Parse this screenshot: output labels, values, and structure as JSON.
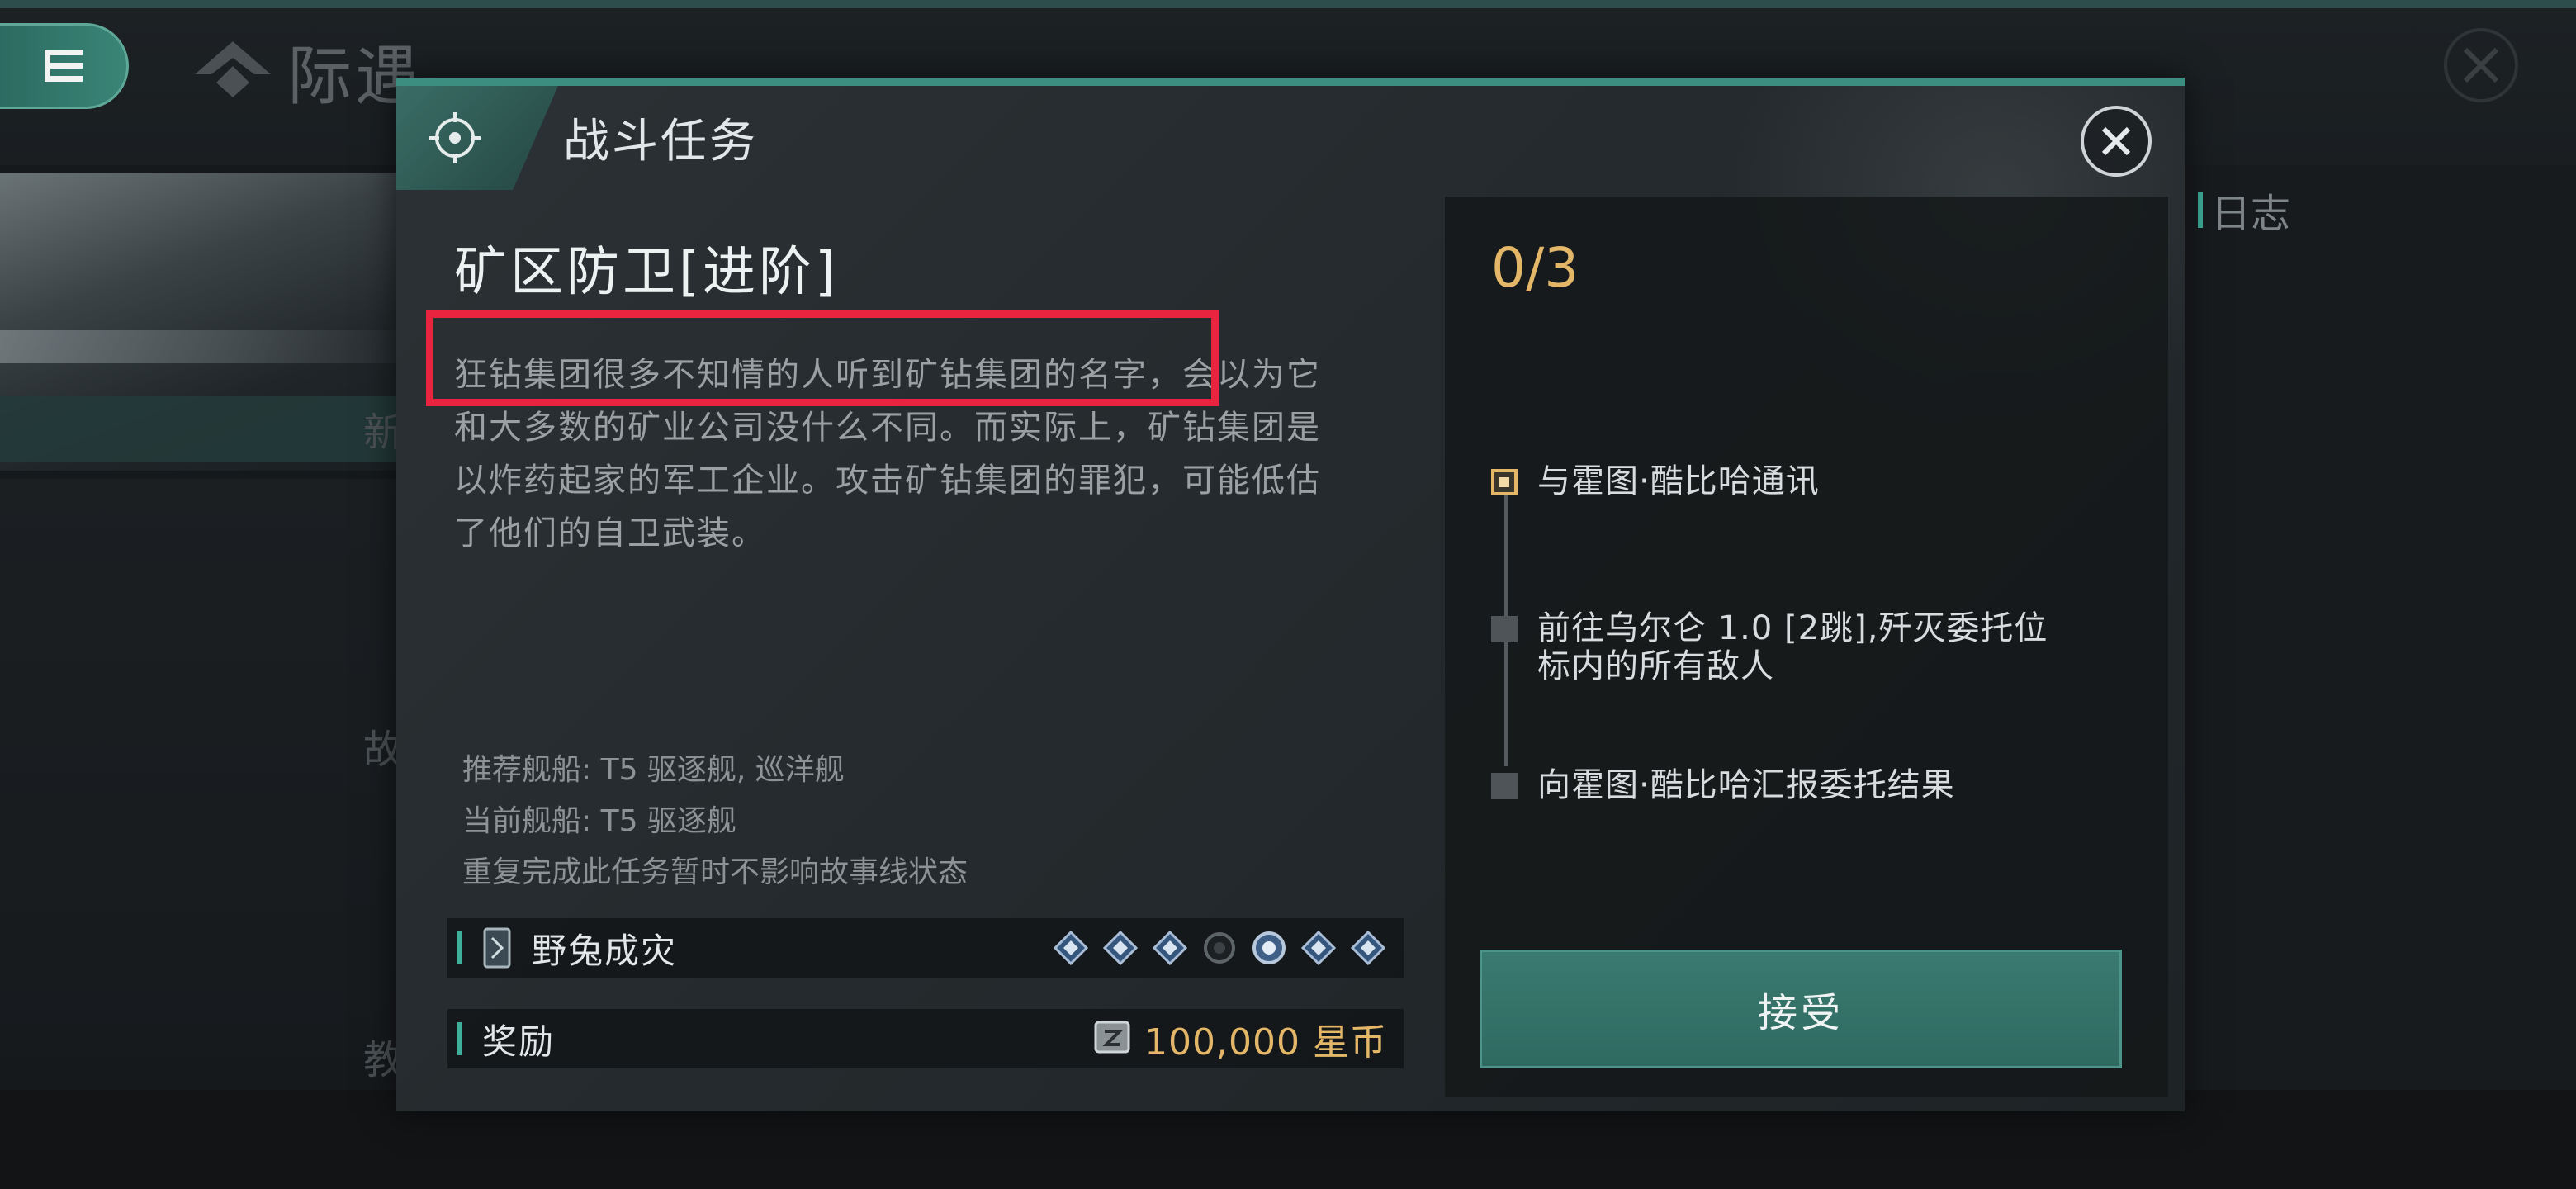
{
  "background": {
    "brand_title": "际遇",
    "log_label": "日志",
    "fragments": [
      "新",
      "故",
      "教"
    ]
  },
  "modal": {
    "title": "战斗任务",
    "mission_name": "矿区防卫[进阶]",
    "description": "狂钻集团很多不知情的人听到矿钻集团的名字，会以为它和大多数的矿业公司没什么不同。而实际上，矿钻集团是以炸药起家的军工企业。攻击矿钻集团的罪犯，可能低估了他们的自卫武装。",
    "notes": {
      "recommended_ship": "推荐舰船: T5 驱逐舰, 巡洋舰",
      "current_ship": "当前舰船: T5 驱逐舰",
      "repeat_note": "重复完成此任务暂时不影响故事线状态"
    },
    "card_row": {
      "label": "野兔成灾",
      "pips": [
        "filled",
        "filled",
        "filled",
        "empty",
        "filled-large",
        "filled",
        "filled"
      ]
    },
    "reward_row": {
      "label": "奖励",
      "value": "100,000 星币"
    }
  },
  "objectives": {
    "progress": "0/3",
    "items": [
      {
        "text": "与霍图·酷比哈通讯",
        "state": "active"
      },
      {
        "text": "前往乌尔仑 1.0 [2跳],歼灭委托位标内的所有敌人",
        "state": "pending"
      },
      {
        "text": "向霍图·酷比哈汇报委托结果",
        "state": "pending"
      }
    ],
    "accept_label": "接受"
  },
  "colors": {
    "accent_teal": "#3fae9a",
    "gold": "#e3b668",
    "highlight_red": "#e8243e",
    "button_green": "#2f6a61"
  }
}
